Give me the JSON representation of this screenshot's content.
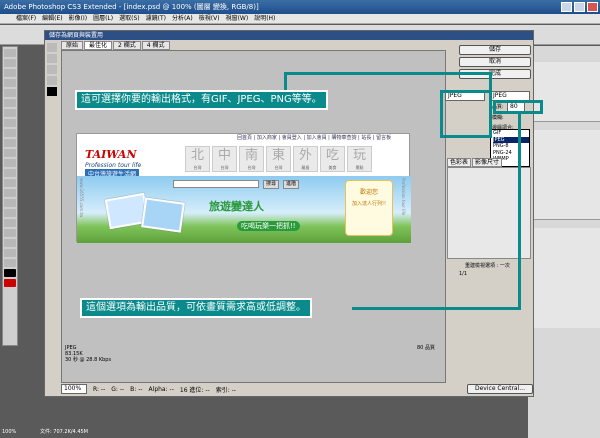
{
  "app": {
    "title": "Adobe Photoshop CS3 Extended - [index.psd @ 100% (圖層 變換, RGB/8)]",
    "menu": [
      "檔案(F)",
      "編輯(E)",
      "影像(I)",
      "圖層(L)",
      "選取(S)",
      "濾鏡(T)",
      "分析(A)",
      "檢視(V)",
      "視窗(W)",
      "說明(H)"
    ],
    "status_zoom": "100%",
    "status_doc": "文件: 707.2K/4.45M"
  },
  "dialog": {
    "title": "儲存為網頁與裝置用",
    "tabs": [
      "原始",
      "最佳化",
      "2 欄式",
      "4 欄式"
    ],
    "buttons": {
      "save": "儲存",
      "cancel": "取消",
      "done": "完成",
      "device_central": "Device Central..."
    },
    "format_value": "JPEG",
    "format_options": [
      "GIF",
      "JPEG",
      "PNG-8",
      "PNG-24",
      "WBMP"
    ],
    "selected_format": "JPEG",
    "quality_label": "品質:",
    "quality_value": "80",
    "blur_label": "模糊:",
    "matte_label": "邊緣調合:",
    "right_tabs": [
      "色彩表",
      "影像尺寸"
    ],
    "table_status": "重建檢視選項 : 一次",
    "counter": "1/1",
    "preview_info": {
      "format": "JPEG",
      "size": "83.15K",
      "time": "30 秒 @ 28.8 Kbps",
      "quality": "80 品質"
    },
    "bottom": {
      "zoom": "100%",
      "r": "R: --",
      "g": "G: --",
      "b": "B: --",
      "alpha": "Alpha: --",
      "hex": "16 進位: --",
      "index": "索引: --"
    }
  },
  "website": {
    "nav": "回首頁 | 加入商家 | 會員登入 | 加入會員 | 購物車查詢 | 站長 | 留言板",
    "logo_en": "TAIWAN",
    "logo_sub": "Profession tour life",
    "logo_cn": "中台灣旅遊生活網",
    "url_vertical": "www.16555.com.tw",
    "categories": [
      {
        "char": "北",
        "label": "台灣"
      },
      {
        "char": "中",
        "label": "台灣"
      },
      {
        "char": "南",
        "label": "台灣"
      },
      {
        "char": "東",
        "label": "台灣"
      },
      {
        "char": "外",
        "label": "離島"
      },
      {
        "char": "吃",
        "label": "美食"
      },
      {
        "char": "玩",
        "label": "景點"
      }
    ],
    "search_button": "搜尋",
    "advanced_button": "進階",
    "banner_title": "旅遊變達人",
    "banner_sub": "吃喝玩樂一把抓!!",
    "welcome_title": "歡迎您",
    "welcome_sub": "加入達人行列!!",
    "side_vertical": "Profession tour life"
  },
  "callouts": {
    "format": "這可選擇你要的輸出格式，有GIF、JPEG、PNG等等。",
    "quality": "這個選項為輸出品質，可依畫質需求高或低調整。"
  },
  "colors": {
    "callout_bg": "#0a8a8a",
    "title_blue": "#2c4f86",
    "accent_red": "#cc0000"
  }
}
